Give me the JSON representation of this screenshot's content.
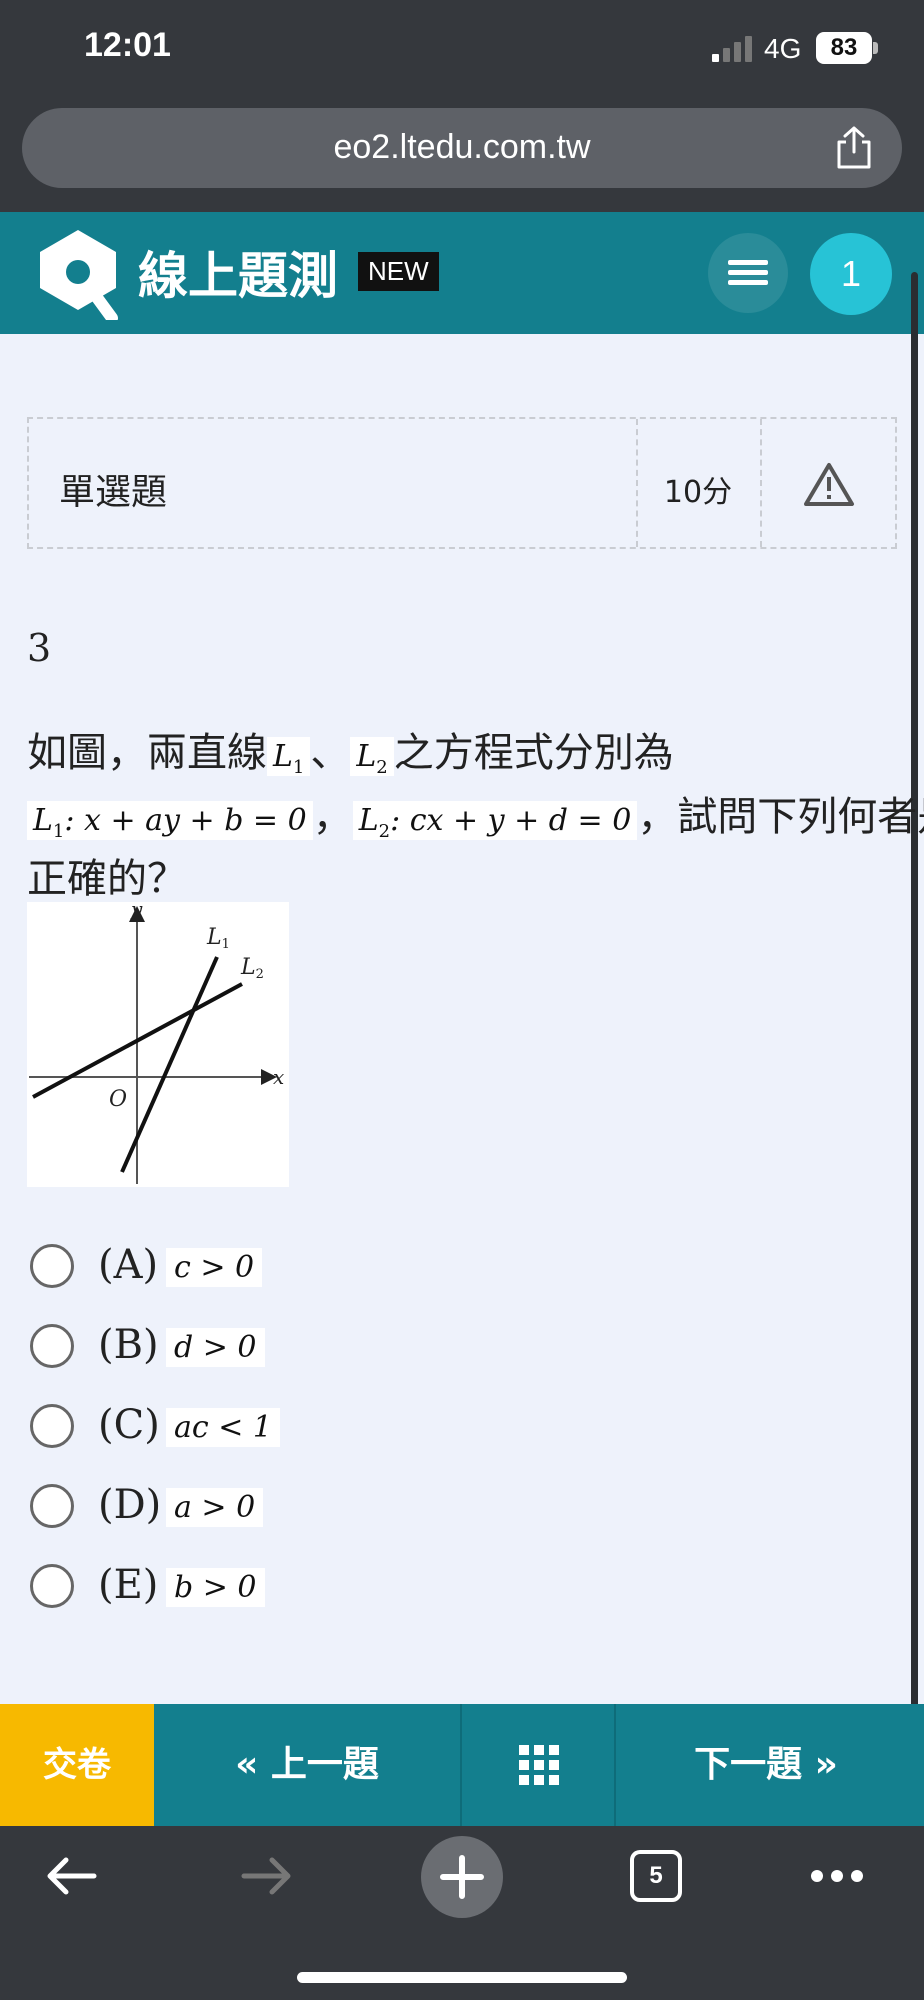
{
  "status_bar": {
    "time": "12:01",
    "network": "4G",
    "battery": "83"
  },
  "browser": {
    "url": "eo2.ltedu.com.tw",
    "tab_count": "5"
  },
  "header": {
    "title": "線上題測",
    "badge": "NEW",
    "user_number": "1"
  },
  "question_info": {
    "type": "單選題",
    "score": "10分"
  },
  "question": {
    "number": "3",
    "text_part1": "如圖，兩直線",
    "l1": "L",
    "l1_sub": "1",
    "sep": "、",
    "l2": "L",
    "l2_sub": "2",
    "text_part2": "之方程式分別為",
    "eq1": ": x + ay + b = 0",
    "comma": "，",
    "eq2": ": cx + y + d = 0",
    "text_part3": "，試問下列何者是",
    "text_part4": "正確的？"
  },
  "figure": {
    "y_label": "y",
    "x_label": "x",
    "origin_label": "O",
    "line1_label": "L",
    "line1_sub": "1",
    "line2_label": "L",
    "line2_sub": "2"
  },
  "options": [
    {
      "label": "(A)",
      "value": "c > 0"
    },
    {
      "label": "(B)",
      "value": "d > 0"
    },
    {
      "label": "(C)",
      "value": "ac < 1"
    },
    {
      "label": "(D)",
      "value": "a > 0"
    },
    {
      "label": "(E)",
      "value": "b > 0"
    }
  ],
  "actions": {
    "submit": "交卷",
    "prev": "上一題",
    "next": "下一題"
  },
  "colors": {
    "header": "#137f8e",
    "submit": "#f7b900",
    "user_badge": "#27c3d6",
    "page_bg": "#eef2fb"
  }
}
